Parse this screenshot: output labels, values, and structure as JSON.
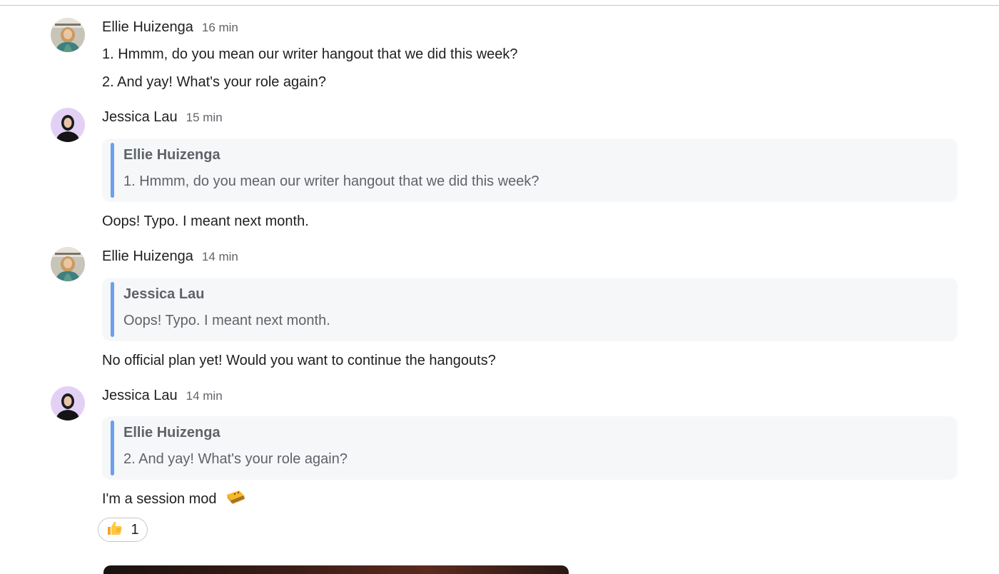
{
  "messages": [
    {
      "sender": "Ellie Huizenga",
      "time": "16 min",
      "lines": [
        "1. Hmmm, do you mean our writer hangout that we did this week?",
        "2. And yay! What's your role again?"
      ]
    },
    {
      "sender": "Jessica Lau",
      "time": "15 min",
      "quote": {
        "sender": "Ellie Huizenga",
        "text": "1. Hmmm, do you mean our writer hangout that we did this week?"
      },
      "text": "Oops! Typo. I meant next month."
    },
    {
      "sender": "Ellie Huizenga",
      "time": "14 min",
      "quote": {
        "sender": "Jessica Lau",
        "text": "Oops! Typo. I meant next month."
      },
      "text": "No official plan yet! Would you want to continue the hangouts?"
    },
    {
      "sender": "Jessica Lau",
      "time": "14 min",
      "quote": {
        "sender": "Ellie Huizenga",
        "text": "2. And yay! What's your role again?"
      },
      "text": "I'm a session mod",
      "text_emoji": "dancing-emoji",
      "reaction": {
        "emoji": "thumbs-up",
        "count": "1"
      }
    }
  ],
  "colors": {
    "quote_bar": "#6b9fef",
    "quote_bg": "#f6f7f9",
    "secondary_text": "#5f6368"
  }
}
